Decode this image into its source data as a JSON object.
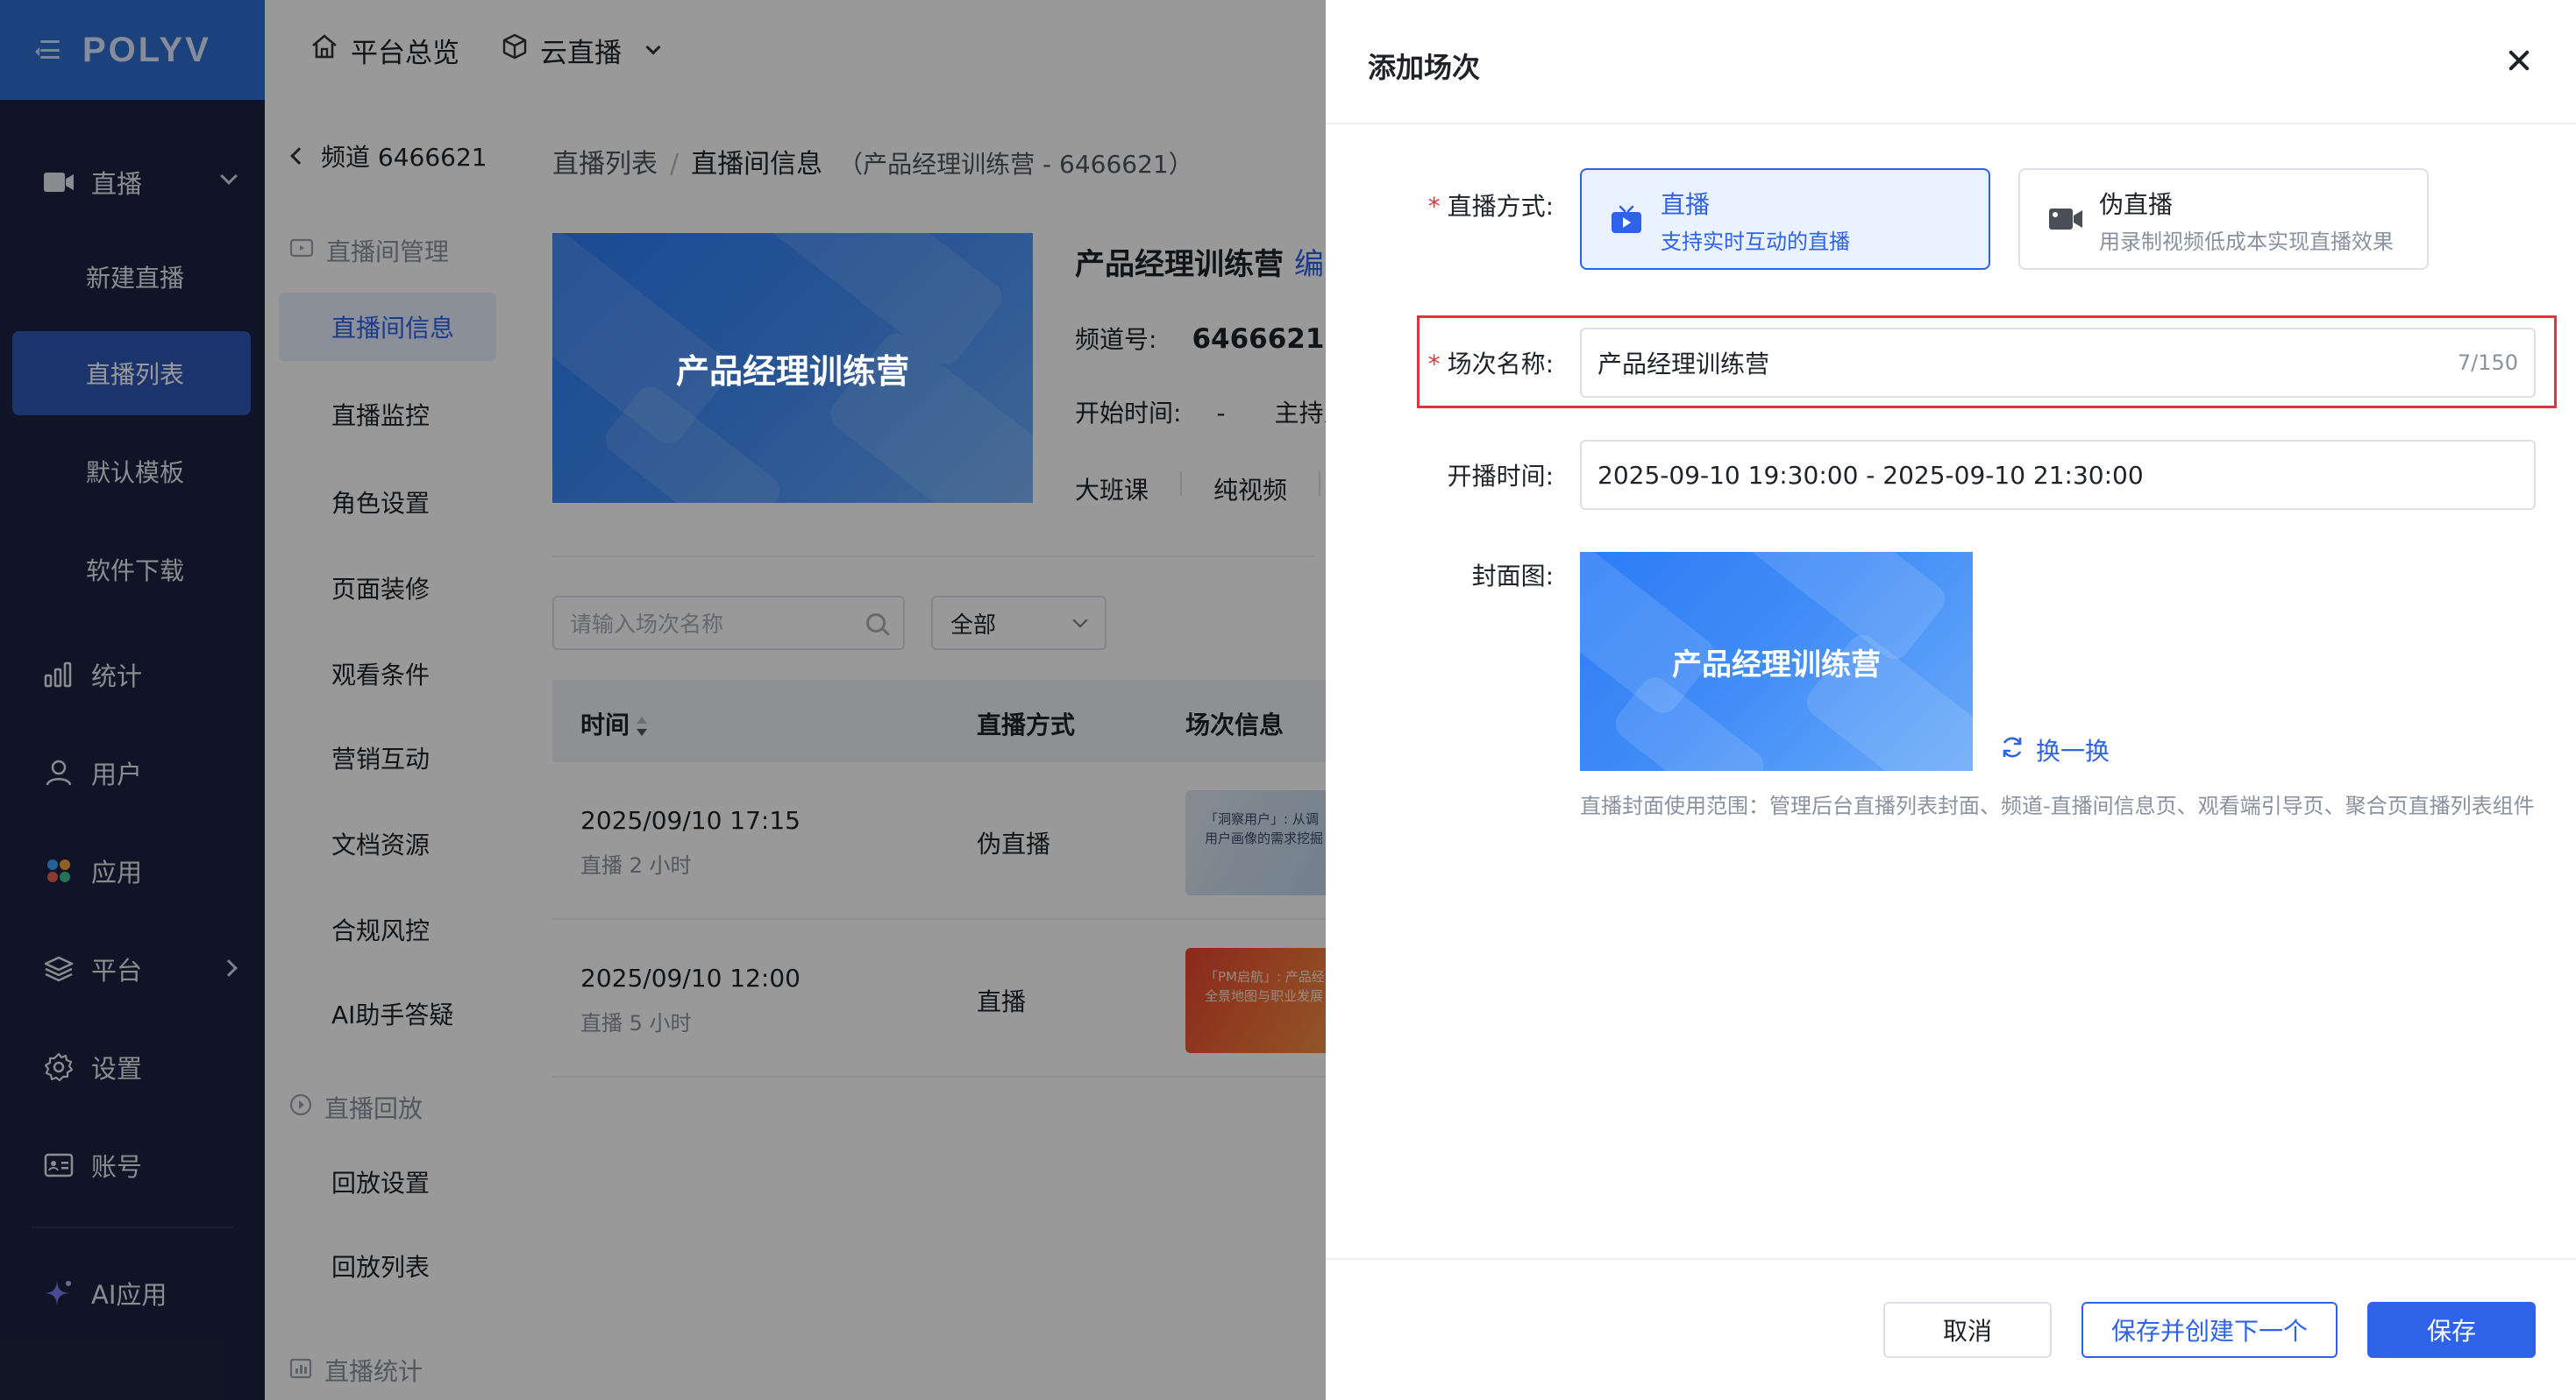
{
  "sidebar": {
    "logo": "POLYV",
    "items": [
      {
        "label": "直播",
        "icon": "camera-icon"
      },
      {
        "label": "统计",
        "icon": "bar-chart-icon"
      },
      {
        "label": "用户",
        "icon": "user-icon"
      },
      {
        "label": "应用",
        "icon": "apps-icon"
      },
      {
        "label": "平台",
        "icon": "layers-icon"
      },
      {
        "label": "设置",
        "icon": "gear-icon"
      },
      {
        "label": "账号",
        "icon": "id-card-icon"
      },
      {
        "label": "AI应用",
        "icon": "sparkle-icon"
      }
    ],
    "live_sub": [
      "新建直播",
      "直播列表",
      "默认模板",
      "软件下载"
    ],
    "active_sub": "直播列表"
  },
  "topbar": {
    "overview": "平台总览",
    "product": "云直播"
  },
  "submenu": {
    "back_label": "频道 6466621",
    "groups": [
      {
        "label": "直播间管理",
        "items": [
          "直播间信息",
          "直播监控",
          "角色设置",
          "页面装修",
          "观看条件",
          "营销互动",
          "文档资源",
          "合规风控",
          "AI助手答疑"
        ]
      },
      {
        "label": "直播回放",
        "items": [
          "回放设置",
          "回放列表"
        ]
      },
      {
        "label": "直播统计",
        "items": []
      }
    ],
    "active": "直播间信息"
  },
  "main": {
    "breadcrumb": {
      "list": "直播列表",
      "current": "直播间信息",
      "context": "（产品经理训练营 - 6466621）"
    },
    "channel": {
      "cover_text": "产品经理训练营",
      "title": "产品经理训练营",
      "edit_partial": "编",
      "channel_no_label": "频道号:",
      "channel_no": "6466621",
      "start_label": "开始时间:",
      "start_value": "-",
      "host_partial": "主持人",
      "tags": [
        "大班课",
        "纯视频"
      ]
    },
    "search_placeholder": "请输入场次名称",
    "filter_value": "全部",
    "table": {
      "headers": [
        "时间",
        "直播方式",
        "场次信息"
      ],
      "rows": [
        {
          "time": "2025/09/10 17:15",
          "duration": "直播 2 小时",
          "mode": "伪直播",
          "thumb_line1": "「洞察用户」: 从调",
          "thumb_line2": "用户画像的需求挖掘"
        },
        {
          "time": "2025/09/10 12:00",
          "duration": "直播 5 小时",
          "mode": "直播",
          "thumb_line1": "「PM启航」: 产品经",
          "thumb_line2": "全景地图与职业发展"
        }
      ]
    }
  },
  "dialog": {
    "title": "添加场次",
    "mode_label": "直播方式:",
    "modes": [
      {
        "title": "直播",
        "desc": "支持实时互动的直播",
        "selected": true
      },
      {
        "title": "伪直播",
        "desc": "用录制视频低成本实现直播效果",
        "selected": false
      }
    ],
    "name_label": "场次名称:",
    "name_value": "产品经理训练营",
    "name_counter": "7/150",
    "time_label": "开播时间:",
    "time_value": "2025-09-10 19:30:00 - 2025-09-10 21:30:00",
    "cover_label": "封面图:",
    "cover_text": "产品经理训练营",
    "swap_label": "换一换",
    "cover_hint": "直播封面使用范围：管理后台直播列表封面、频道-直播间信息页、观看端引导页、聚合页直播列表组件",
    "buttons": {
      "cancel": "取消",
      "save_next": "保存并创建下一个",
      "save": "保存"
    }
  },
  "colors": {
    "primary": "#2e62e8",
    "sidebar_bg": "#1a2440",
    "logo_bg": "#2f6ed1",
    "required": "#e0353d"
  }
}
